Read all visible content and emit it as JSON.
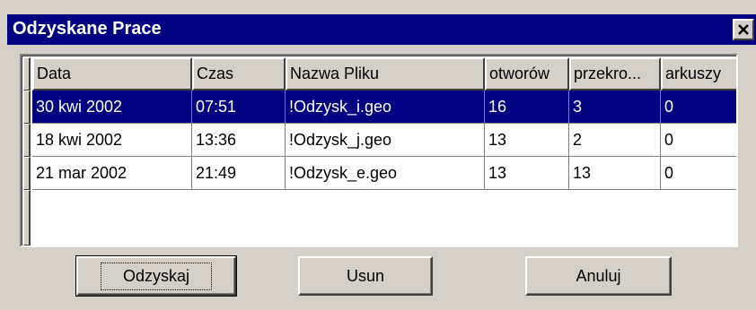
{
  "window": {
    "title": "Odzyskane Prace",
    "close_glyph": "×"
  },
  "table": {
    "columns": [
      "Data",
      "Czas",
      "Nazwa Pliku",
      "otworów",
      "przekro...",
      "arkuszy"
    ],
    "rows": [
      {
        "selected": true,
        "cells": [
          "30 kwi 2002",
          "07:51",
          "!Odzysk_i.geo",
          "16",
          "3",
          "0"
        ]
      },
      {
        "selected": false,
        "cells": [
          "18 kwi 2002",
          "13:36",
          "!Odzysk_j.geo",
          "13",
          "2",
          "0"
        ]
      },
      {
        "selected": false,
        "cells": [
          "21 mar 2002",
          "21:49",
          "!Odzysk_e.geo",
          "13",
          "13",
          "0"
        ]
      }
    ]
  },
  "buttons": {
    "recover": "Odzyskaj",
    "delete": "Usun",
    "cancel": "Anuluj"
  },
  "colors": {
    "titlebar": "#000080",
    "selection": "#000080",
    "face": "#d4d0c8"
  }
}
